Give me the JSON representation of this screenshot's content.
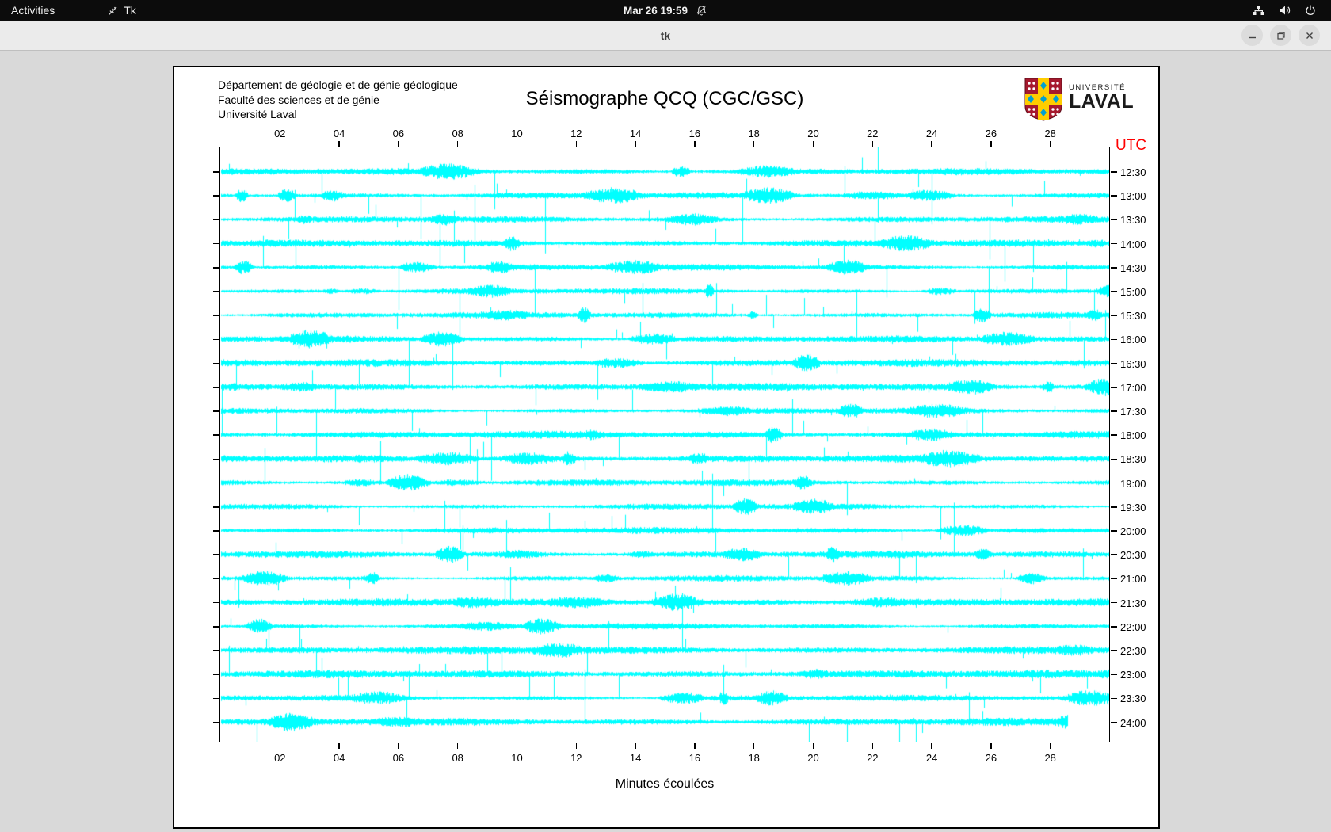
{
  "top_bar": {
    "activities_label": "Activities",
    "app_menu_label": "Tk",
    "clock_label": "Mar 26 19:59",
    "icons": {
      "app_icon": "tk-feather-icon",
      "notifications": "bell-muted-icon",
      "network": "wired-network-icon",
      "volume": "speaker-icon",
      "power": "power-icon"
    }
  },
  "window": {
    "title": "tk",
    "minimize_label": "minimize",
    "maximize_label": "maximize",
    "close_label": "close"
  },
  "document": {
    "header_lines": [
      "Département de géologie et de génie géologique",
      "Faculté des sciences et de génie",
      "Université Laval"
    ],
    "logo": {
      "university_word": "UNIVERSITÉ",
      "laval_word": "LAVAL",
      "shield_red": "#a6192e",
      "cross_yellow": "#ffcd00",
      "diamond_blue": "#00a0d2"
    }
  },
  "chart_data": {
    "type": "line",
    "title": "Séismographe QCQ (CGC/GSC)",
    "xlabel": "Minutes écoulées",
    "x_range_minutes": [
      0,
      30
    ],
    "x_tick_minutes": [
      2,
      4,
      6,
      8,
      10,
      12,
      14,
      16,
      18,
      20,
      22,
      24,
      26,
      28
    ],
    "x_tick_labels": [
      "02",
      "04",
      "06",
      "08",
      "10",
      "12",
      "14",
      "16",
      "18",
      "20",
      "22",
      "24",
      "26",
      "28"
    ],
    "right_axis": {
      "header": "UTC",
      "header_color": "#ff0000",
      "row_labels": [
        "12:30",
        "13:00",
        "13:30",
        "14:00",
        "14:30",
        "15:00",
        "15:30",
        "16:00",
        "16:30",
        "17:00",
        "17:30",
        "18:00",
        "18:30",
        "19:00",
        "19:30",
        "20:00",
        "20:30",
        "21:00",
        "21:30",
        "22:00",
        "22:30",
        "23:00",
        "23:30",
        "24:00"
      ]
    },
    "trace_color": "#00ffff",
    "row_interval_minutes": 30,
    "last_row_end_minute": 28.6,
    "noise_seed": 326195
  }
}
